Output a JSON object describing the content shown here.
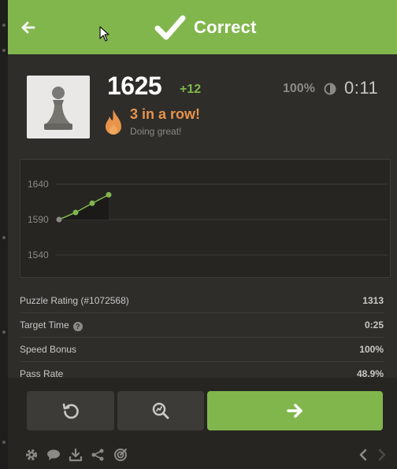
{
  "header": {
    "title": "Correct",
    "color": "#81b64c"
  },
  "player": {
    "rating": "1625",
    "rating_delta": "+12",
    "accuracy": "100%",
    "timer": "0:11",
    "streak": "3 in a row!",
    "streak_sub": "Doing great!"
  },
  "chart_data": {
    "type": "line",
    "y_ticks": [
      "1640",
      "1590",
      "1540"
    ],
    "ylim": [
      1540,
      1640
    ],
    "x": [
      1,
      2,
      3,
      4
    ],
    "values": [
      1590,
      1600,
      1613,
      1625
    ],
    "grid": true
  },
  "stats": [
    {
      "label": "Puzzle Rating (#1072568)",
      "value": "1313"
    },
    {
      "label": "Target Time",
      "value": "0:25",
      "help": true
    },
    {
      "label": "Speed Bonus",
      "value": "100%"
    },
    {
      "label": "Pass Rate",
      "value": "48.9%"
    }
  ],
  "icons": {
    "back": "arrow-left-icon",
    "check": "check-icon",
    "retry": "retry-icon",
    "analyze": "analysis-icon",
    "next": "arrow-right-icon",
    "settings": "gear-icon",
    "chat": "chat-icon",
    "download": "download-icon",
    "share": "share-icon",
    "target": "target-icon",
    "prev": "chevron-left-icon",
    "fwd": "chevron-right-icon"
  }
}
